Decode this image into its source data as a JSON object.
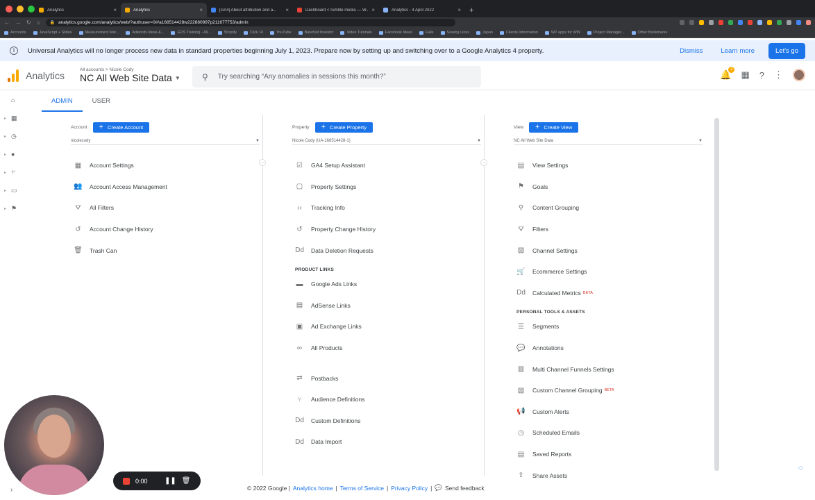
{
  "browser": {
    "tabs": [
      {
        "label": "Analytics",
        "active": false,
        "color": "#f9ab00"
      },
      {
        "label": "Analytics",
        "active": true,
        "color": "#f9ab00"
      },
      {
        "label": "[GA4] About attribution and a...",
        "active": false,
        "color": "#4285f4"
      },
      {
        "label": "Dashboard < rumble media — W...",
        "active": false,
        "color": "#ea4335"
      },
      {
        "label": "Analytics - 4 April 2022",
        "active": false,
        "color": "#8ab4f8"
      }
    ],
    "url": "analytics.google.com/analytics/web/?authuser=0#/a168514428w222880997p211677753/admin",
    "bookmarks": [
      "Accounts",
      "JavaScript + Slides",
      "Measurement Mar...",
      "Adwords ideas &...",
      "GDS Training - All...",
      "Shopify",
      "Click UI",
      "YouTube",
      "Barefoot Investor",
      "Video Tutorials",
      "Facebook Ideas",
      "Fails",
      "Sewing Links",
      "Japan",
      "Clients Information",
      "WP apps for WW",
      "Project Manager...",
      "Other Bookmarks"
    ]
  },
  "banner": {
    "message": "Universal Analytics will no longer process new data in standard properties beginning July 1, 2023. Prepare now by setting up and switching over to a Google Analytics 4 property.",
    "dismiss": "Dismiss",
    "learn_more": "Learn more",
    "cta": "Let's go"
  },
  "header": {
    "product": "Analytics",
    "breadcrumb": "All accounts > Nicole Cody",
    "view_name": "NC All Web Site Data",
    "search_placeholder": "Try searching “Any anomalies in sessions this month?”",
    "notifications": "2"
  },
  "admin_tabs": [
    "ADMIN",
    "USER"
  ],
  "account": {
    "label": "Account",
    "create": "Create Account",
    "selected": "nicolecody",
    "items": [
      {
        "icon": "building-icon",
        "glyph": "▦",
        "label": "Account Settings"
      },
      {
        "icon": "people-icon",
        "glyph": "👥",
        "label": "Account Access Management"
      },
      {
        "icon": "filter-icon",
        "glyph": "⛛",
        "label": "All Filters"
      },
      {
        "icon": "history-icon",
        "glyph": "↺",
        "label": "Account Change History"
      },
      {
        "icon": "trash-icon",
        "glyph": "🗑",
        "label": "Trash Can"
      }
    ]
  },
  "property": {
    "label": "Property",
    "create": "Create Property",
    "selected": "Nicole Cody (UA-168514428-1)",
    "items": [
      {
        "icon": "checkbox-icon",
        "glyph": "☑",
        "label": "GA4 Setup Assistant"
      },
      {
        "icon": "window-icon",
        "glyph": "▢",
        "label": "Property Settings"
      },
      {
        "icon": "code-icon",
        "glyph": "‹›",
        "label": "Tracking Info"
      },
      {
        "icon": "history-icon",
        "glyph": "↺",
        "label": "Property Change History"
      },
      {
        "icon": "dd-icon",
        "glyph": "Dd",
        "label": "Data Deletion Requests"
      }
    ],
    "links_section": "PRODUCT LINKS",
    "links": [
      {
        "icon": "google-ads-icon",
        "glyph": "▬",
        "label": "Google Ads Links"
      },
      {
        "icon": "adsense-icon",
        "glyph": "▤",
        "label": "AdSense Links"
      },
      {
        "icon": "ad-exchange-icon",
        "glyph": "▣",
        "label": "Ad Exchange Links"
      },
      {
        "icon": "link-icon",
        "glyph": "∞",
        "label": "All Products"
      }
    ],
    "more": [
      {
        "icon": "postbacks-icon",
        "glyph": "⇄",
        "label": "Postbacks"
      },
      {
        "icon": "audience-icon",
        "glyph": "⑂",
        "label": "Audience Definitions"
      },
      {
        "icon": "dd-icon",
        "glyph": "Dd",
        "label": "Custom Definitions"
      },
      {
        "icon": "dd-icon",
        "glyph": "Dd",
        "label": "Data Import"
      }
    ]
  },
  "view": {
    "label": "View",
    "create": "Create View",
    "selected": "NC All Web Site Data",
    "items": [
      {
        "icon": "document-icon",
        "glyph": "▤",
        "label": "View Settings"
      },
      {
        "icon": "flag-icon",
        "glyph": "⚑",
        "label": "Goals"
      },
      {
        "icon": "person-icon",
        "glyph": "⚲",
        "label": "Content Grouping"
      },
      {
        "icon": "filter-icon",
        "glyph": "⛛",
        "label": "Filters"
      },
      {
        "icon": "channel-icon",
        "glyph": "▧",
        "label": "Channel Settings"
      },
      {
        "icon": "cart-icon",
        "glyph": "🛒",
        "label": "Ecommerce Settings"
      },
      {
        "icon": "dd-icon",
        "glyph": "Dd",
        "label": "Calculated Metrics",
        "badge": "BETA"
      }
    ],
    "tools_section": "PERSONAL TOOLS & ASSETS",
    "tools": [
      {
        "icon": "segments-icon",
        "glyph": "☰",
        "label": "Segments"
      },
      {
        "icon": "comment-icon",
        "glyph": "💬",
        "label": "Annotations"
      },
      {
        "icon": "bar-chart-icon",
        "glyph": "▥",
        "label": "Multi Channel Funnels Settings"
      },
      {
        "icon": "channel-icon",
        "glyph": "▧",
        "label": "Custom Channel Grouping",
        "badge": "BETA"
      },
      {
        "icon": "megaphone-icon",
        "glyph": "📢",
        "label": "Custom Alerts"
      },
      {
        "icon": "clock-icon",
        "glyph": "◷",
        "label": "Scheduled Emails"
      },
      {
        "icon": "report-icon",
        "glyph": "▤",
        "label": "Saved Reports"
      },
      {
        "icon": "share-icon",
        "glyph": "⇪",
        "label": "Share Assets"
      }
    ]
  },
  "footer": {
    "copyright": "© 2022 Google |",
    "home": "Analytics home",
    "terms": "Terms of Service",
    "privacy": "Privacy Policy",
    "feedback": "Send feedback"
  },
  "recorder": {
    "time": "0:00"
  }
}
